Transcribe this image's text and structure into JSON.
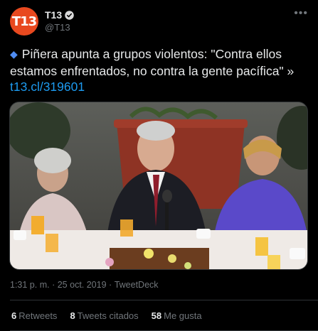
{
  "author": {
    "avatar_text": "T13",
    "display_name": "T13",
    "handle": "@T13",
    "avatar_color": "#e8491f",
    "verified": true
  },
  "tweet": {
    "text": "Piñera apunta a grupos violentos: \"Contra ellos estamos enfrentados, no contra la gente pacífica\" »",
    "link": "t13.cl/319601",
    "icon": "diamond-icon"
  },
  "media": {
    "type": "photo"
  },
  "meta": {
    "time": "1:31 p. m.",
    "separator": "·",
    "date": "25 oct. 2019",
    "source": "TweetDeck"
  },
  "stats": [
    {
      "count": "6",
      "label": "Retweets"
    },
    {
      "count": "8",
      "label": "Tweets citados"
    },
    {
      "count": "58",
      "label": "Me gusta"
    }
  ],
  "colors": {
    "link": "#1d9bf0",
    "muted": "#71767b",
    "background": "#000000"
  }
}
